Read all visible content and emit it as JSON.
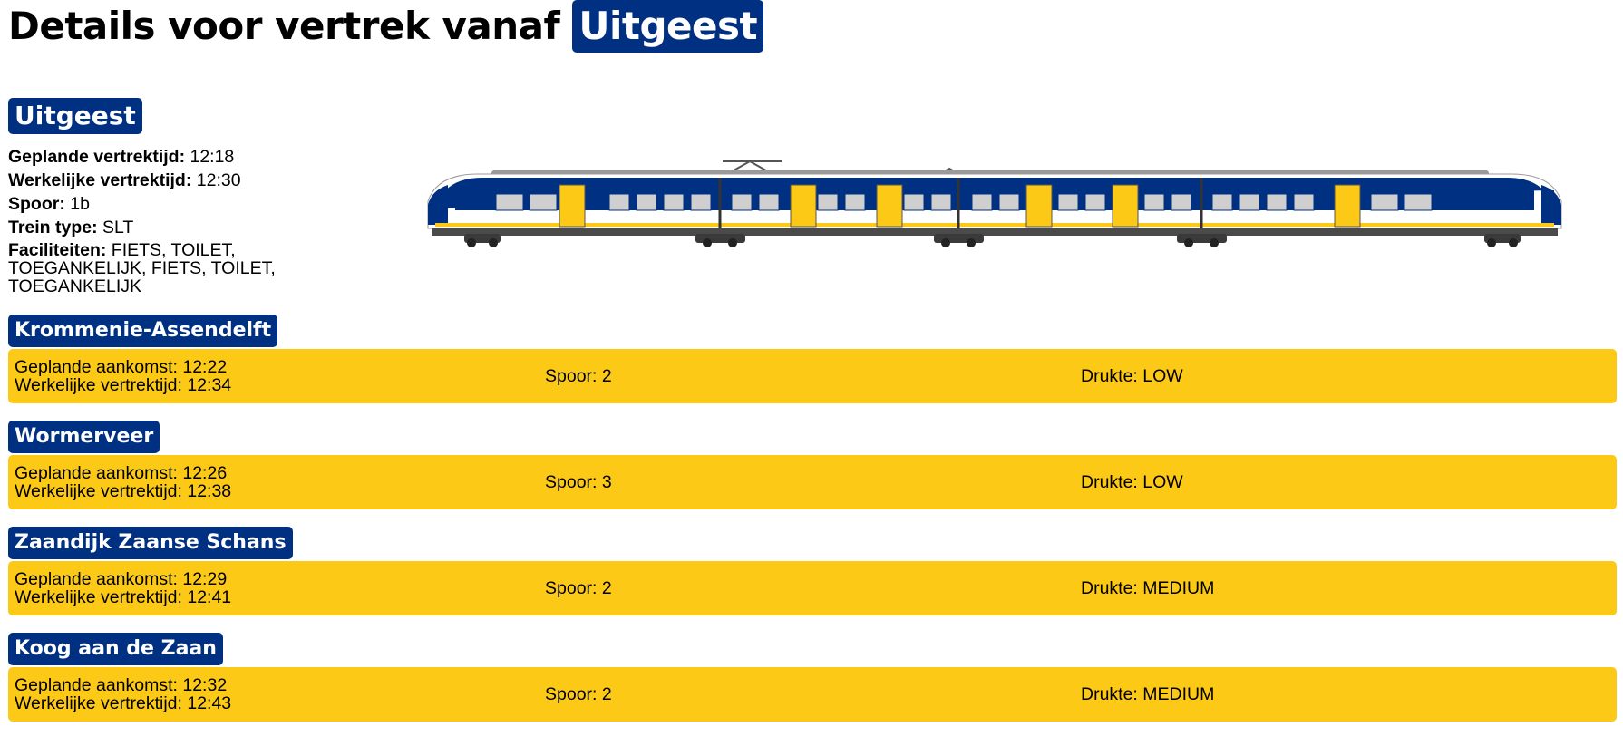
{
  "header": {
    "title_prefix": "Details voor vertrek vanaf",
    "station": "Uitgeest"
  },
  "origin": {
    "station": "Uitgeest",
    "planned_label": "Geplande vertrektijd:",
    "planned_value": "12:18",
    "actual_label": "Werkelijke vertrektijd:",
    "actual_value": "12:30",
    "platform_label": "Spoor:",
    "platform_value": "1b",
    "type_label": "Trein type:",
    "type_value": "SLT",
    "facilities_label": "Faciliteiten:",
    "facilities_value": "FIETS, TOILET, TOEGANKELIJK, FIETS, TOILET, TOEGANKELIJK"
  },
  "stops": [
    {
      "station": "Krommenie-Assendelft",
      "planned": "Geplande aankomst: 12:22",
      "actual": "Werkelijke vertrektijd: 12:34",
      "platform": "Spoor: 2",
      "crowd": "Drukte: LOW"
    },
    {
      "station": "Wormerveer",
      "planned": "Geplande aankomst: 12:26",
      "actual": "Werkelijke vertrektijd: 12:38",
      "platform": "Spoor: 3",
      "crowd": "Drukte: LOW"
    },
    {
      "station": "Zaandijk Zaanse Schans",
      "planned": "Geplande aankomst: 12:29",
      "actual": "Werkelijke vertrektijd: 12:41",
      "platform": "Spoor: 2",
      "crowd": "Drukte: MEDIUM"
    },
    {
      "station": "Koog aan de Zaan",
      "planned": "Geplande aankomst: 12:32",
      "actual": "Werkelijke vertrektijd: 12:43",
      "platform": "Spoor: 2",
      "crowd": "Drukte: MEDIUM"
    }
  ],
  "colors": {
    "ns_blue": "#003082",
    "ns_yellow": "#fcc917"
  },
  "train_image": {
    "icon": "slt-train-illustration"
  }
}
